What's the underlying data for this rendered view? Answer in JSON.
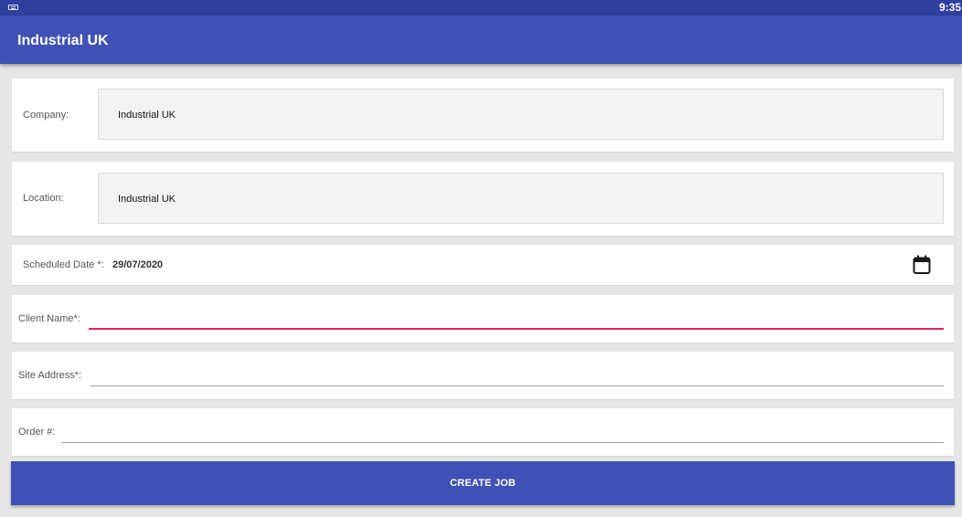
{
  "status_bar": {
    "time": "9:35",
    "keyboard_icon": "keyboard-icon"
  },
  "app_bar": {
    "title": "Industrial UK"
  },
  "form": {
    "company": {
      "label": "Company:",
      "value": "Industrial UK"
    },
    "location": {
      "label": "Location:",
      "value": "Industrial UK"
    },
    "scheduled_date": {
      "label": "Scheduled Date *:",
      "value": "29/07/2020",
      "icon": "calendar-icon"
    },
    "client_name": {
      "label": "Client Name*:",
      "value": ""
    },
    "site_address": {
      "label": "Site Address*:",
      "value": ""
    },
    "order_number": {
      "label": "Order #:",
      "value": ""
    }
  },
  "actions": {
    "create_job_label": "CREATE JOB"
  },
  "colors": {
    "status_bar": "#2f3f9e",
    "primary": "#3f51b5",
    "accent": "#e91e63",
    "background": "#e6e6e6"
  }
}
